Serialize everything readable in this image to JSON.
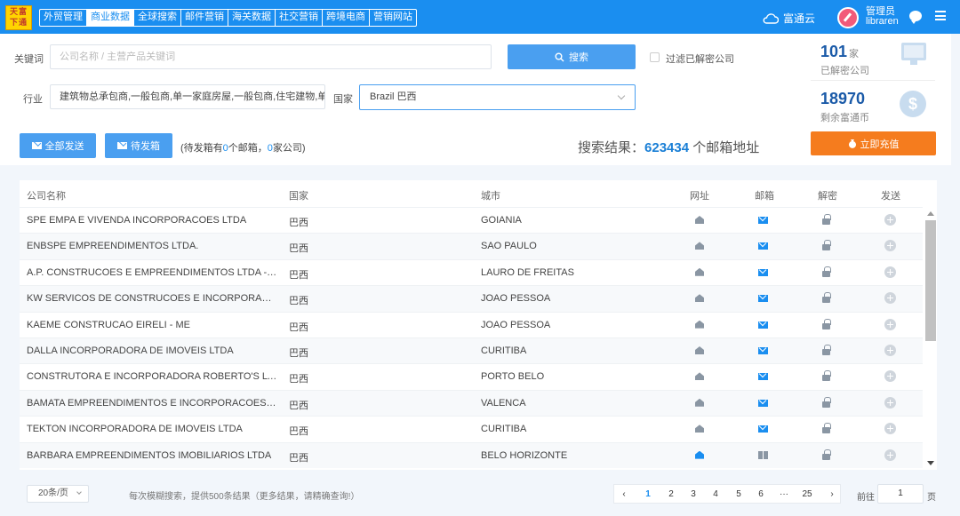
{
  "logo": {
    "text": "天下富通"
  },
  "nav": {
    "tabs": [
      "外贸管理",
      "商业数据",
      "全球搜索",
      "邮件营销",
      "海关数据",
      "社交营销",
      "跨境电商",
      "营销网站"
    ],
    "active_index": 1
  },
  "header": {
    "cloud_label": "富通云",
    "user_role": "管理员",
    "user_name": "libraren",
    "cloud_icon": "cloud-icon",
    "chat_icon": "chat-icon",
    "menu_icon": "menu-icon"
  },
  "search": {
    "keyword_label": "关键词",
    "keyword_placeholder": "公司名称 / 主营产品关键词",
    "search_button": "搜索",
    "filter_checkbox_label": "过滤已解密公司",
    "industry_label": "行业",
    "industry_value": "建筑物总承包商,一般包商,单一家庭房屋,一般包商,住宅建物,单一",
    "country_label": "国家",
    "country_value": "Brazil 巴西"
  },
  "actions": {
    "send_all": "全部发送",
    "outbox": "待发箱",
    "pending_prefix": "(待发箱有",
    "pending_mail_count": "0",
    "pending_mid": "个邮箱，",
    "pending_company_count": "0",
    "pending_suffix": "家公司)"
  },
  "result": {
    "prefix": "搜索结果：",
    "count": "623434",
    "suffix": " 个邮箱地址"
  },
  "stats": {
    "decrypted_count": "101",
    "decrypted_unit": "家",
    "decrypted_label": "已解密公司",
    "coins_count": "18970",
    "coins_label": "剩余富通币",
    "recharge_button": "立即充值"
  },
  "table": {
    "headers": [
      "公司名称",
      "国家",
      "城市",
      "网址",
      "邮箱",
      "解密",
      "发送"
    ],
    "rows": [
      {
        "company": "SPE EMPA E VIVENDA INCORPORACOES LTDA",
        "country": "巴西",
        "city": "GOIANIA",
        "web": "home",
        "mail": "envelope"
      },
      {
        "company": "ENBSPE EMPREENDIMENTOS LTDA.",
        "country": "巴西",
        "city": "SAO PAULO",
        "web": "home",
        "mail": "envelope"
      },
      {
        "company": "A.P. CONSTRUCOES E EMPREENDIMENTOS LTDA - ME",
        "country": "巴西",
        "city": "LAURO DE FREITAS",
        "web": "home",
        "mail": "envelope"
      },
      {
        "company": "KW SERVICOS DE CONSTRUCOES E INCORPORACOES LTDA",
        "country": "巴西",
        "city": "JOAO PESSOA",
        "web": "home",
        "mail": "envelope"
      },
      {
        "company": "KAEME CONSTRUCAO EIRELI - ME",
        "country": "巴西",
        "city": "JOAO PESSOA",
        "web": "home",
        "mail": "envelope"
      },
      {
        "company": "DALLA INCORPORADORA DE IMOVEIS LTDA",
        "country": "巴西",
        "city": "CURITIBA",
        "web": "home",
        "mail": "envelope"
      },
      {
        "company": "CONSTRUTORA E INCORPORADORA ROBERTO'S LTDA - EPP",
        "country": "巴西",
        "city": "PORTO BELO",
        "web": "home",
        "mail": "envelope"
      },
      {
        "company": "BAMATA EMPREENDIMENTOS E INCORPORACOES LTDA - ME",
        "country": "巴西",
        "city": "VALENCA",
        "web": "home",
        "mail": "envelope"
      },
      {
        "company": "TEKTON INCORPORADORA DE IMOVEIS LTDA",
        "country": "巴西",
        "city": "CURITIBA",
        "web": "home",
        "mail": "envelope"
      },
      {
        "company": "BARBARA EMPREENDIMENTOS IMOBILIARIOS LTDA",
        "country": "巴西",
        "city": "BELO HORIZONTE",
        "web": "home-active",
        "mail": "gift"
      }
    ]
  },
  "footer": {
    "page_size": "20条/页",
    "tip": "每次模糊搜索，提供500条结果（更多结果，请精确查询!）",
    "pages": [
      "1",
      "2",
      "3",
      "4",
      "5",
      "6",
      "···",
      "25"
    ],
    "current_page": "1",
    "prev": "‹",
    "next": "›",
    "goto_label": "前往",
    "goto_value": "1",
    "page_label": "页"
  },
  "colors": {
    "brand_blue": "#1a8ef0",
    "button_blue": "#4a9ff0",
    "recharge_orange": "#f57c1e"
  }
}
